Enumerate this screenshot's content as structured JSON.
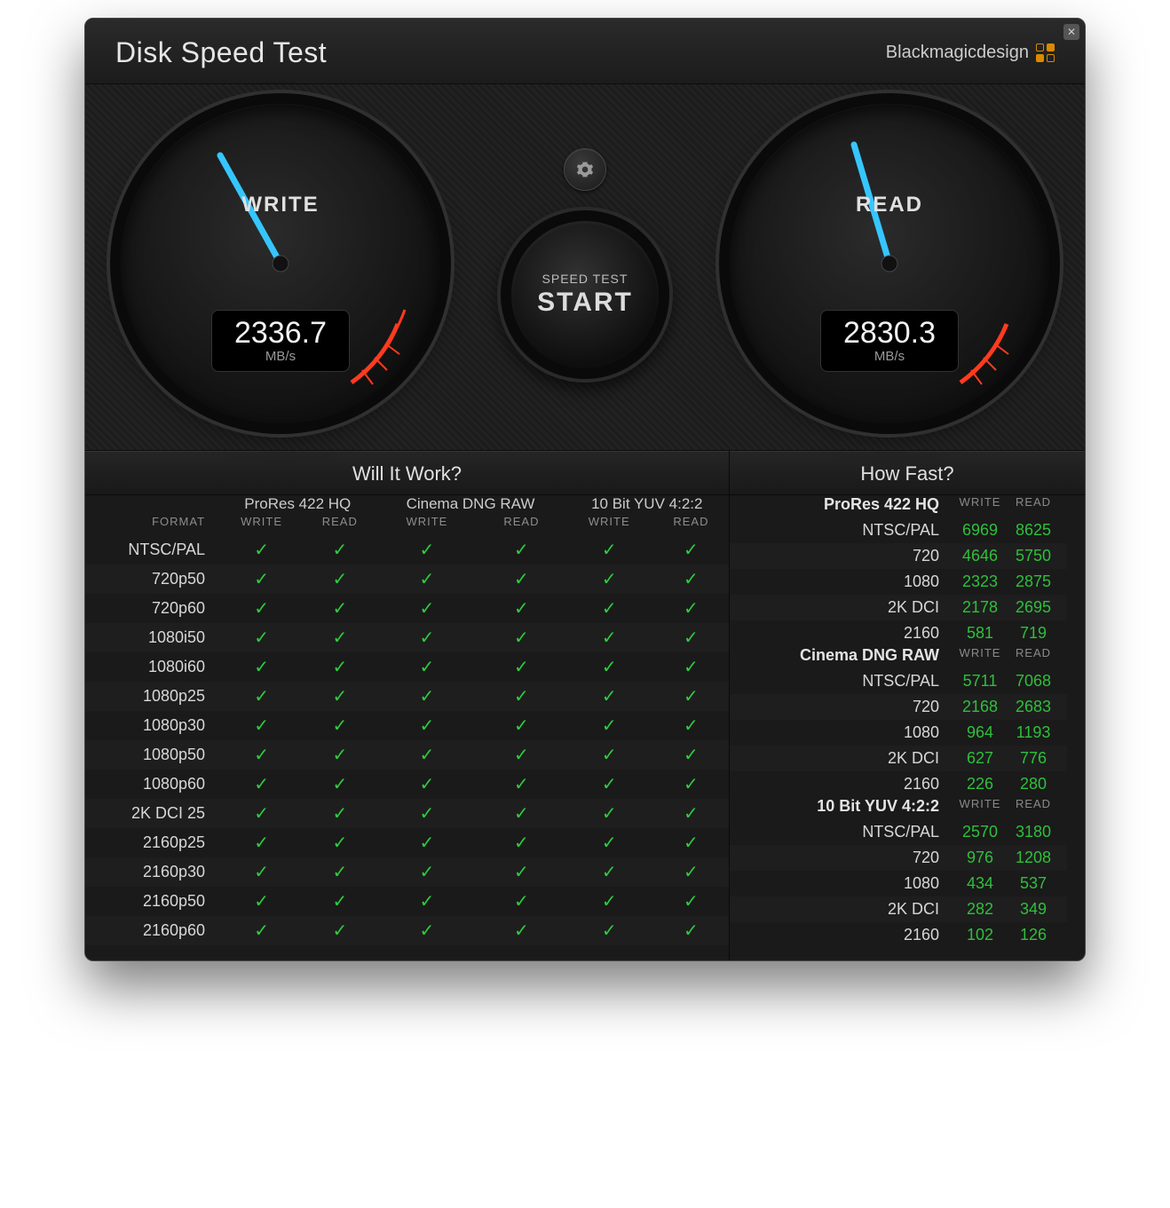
{
  "app": {
    "title": "Disk Speed Test",
    "brand": "Blackmagicdesign"
  },
  "controls": {
    "settings_icon": "gear-icon",
    "start_small": "SPEED TEST",
    "start_big": "START"
  },
  "gauges": {
    "write": {
      "label": "WRITE",
      "value": "2336.7",
      "unit": "MB/s",
      "max": 9000
    },
    "read": {
      "label": "READ",
      "value": "2830.3",
      "unit": "MB/s",
      "max": 9000
    }
  },
  "panels": {
    "will_title": "Will It Work?",
    "fast_title": "How Fast?",
    "codecs": [
      "ProRes 422 HQ",
      "Cinema DNG RAW",
      "10 Bit YUV 4:2:2"
    ],
    "sub_header": [
      "WRITE",
      "READ"
    ],
    "format_label": "FORMAT",
    "formats": [
      "NTSC/PAL",
      "720p50",
      "720p60",
      "1080i50",
      "1080i60",
      "1080p25",
      "1080p30",
      "1080p50",
      "1080p60",
      "2K DCI 25",
      "2160p25",
      "2160p30",
      "2160p50",
      "2160p60"
    ],
    "how_fast": [
      {
        "title": "ProRes 422 HQ",
        "rows": [
          {
            "name": "NTSC/PAL",
            "write": 6969,
            "read": 8625
          },
          {
            "name": "720",
            "write": 4646,
            "read": 5750
          },
          {
            "name": "1080",
            "write": 2323,
            "read": 2875
          },
          {
            "name": "2K DCI",
            "write": 2178,
            "read": 2695
          },
          {
            "name": "2160",
            "write": 581,
            "read": 719
          }
        ]
      },
      {
        "title": "Cinema DNG RAW",
        "rows": [
          {
            "name": "NTSC/PAL",
            "write": 5711,
            "read": 7068
          },
          {
            "name": "720",
            "write": 2168,
            "read": 2683
          },
          {
            "name": "1080",
            "write": 964,
            "read": 1193
          },
          {
            "name": "2K DCI",
            "write": 627,
            "read": 776
          },
          {
            "name": "2160",
            "write": 226,
            "read": 280
          }
        ]
      },
      {
        "title": "10 Bit YUV 4:2:2",
        "rows": [
          {
            "name": "NTSC/PAL",
            "write": 2570,
            "read": 3180
          },
          {
            "name": "720",
            "write": 976,
            "read": 1208
          },
          {
            "name": "1080",
            "write": 434,
            "read": 537
          },
          {
            "name": "2K DCI",
            "write": 282,
            "read": 349
          },
          {
            "name": "2160",
            "write": 102,
            "read": 126
          }
        ]
      }
    ]
  }
}
